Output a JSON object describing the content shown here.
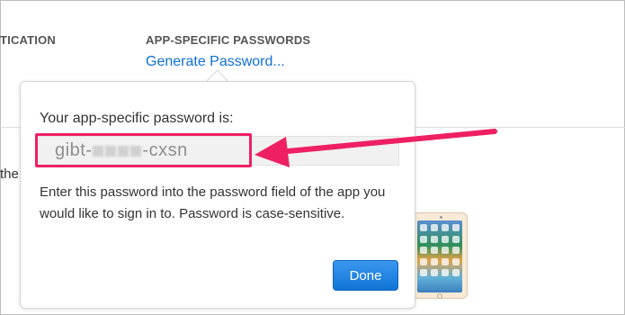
{
  "header": {
    "left_section_label": "TICATION",
    "right_section_label": "APP-SPECIFIC PASSWORDS",
    "generate_link": "Generate Password..."
  },
  "background": {
    "side_text": "the"
  },
  "popover": {
    "label": "Your app-specific password is:",
    "password_prefix": "gibt-",
    "password_suffix": "-cxsn",
    "instructions": "Enter this password into the password field of the app you would like to sign in to. Password is case-sensitive.",
    "done_label": "Done"
  },
  "colors": {
    "link": "#0f6fd6",
    "annotation": "#ee1f63",
    "button": "#1175d6"
  },
  "icons": [
    "ipad-device-image",
    "annotation-arrow"
  ]
}
